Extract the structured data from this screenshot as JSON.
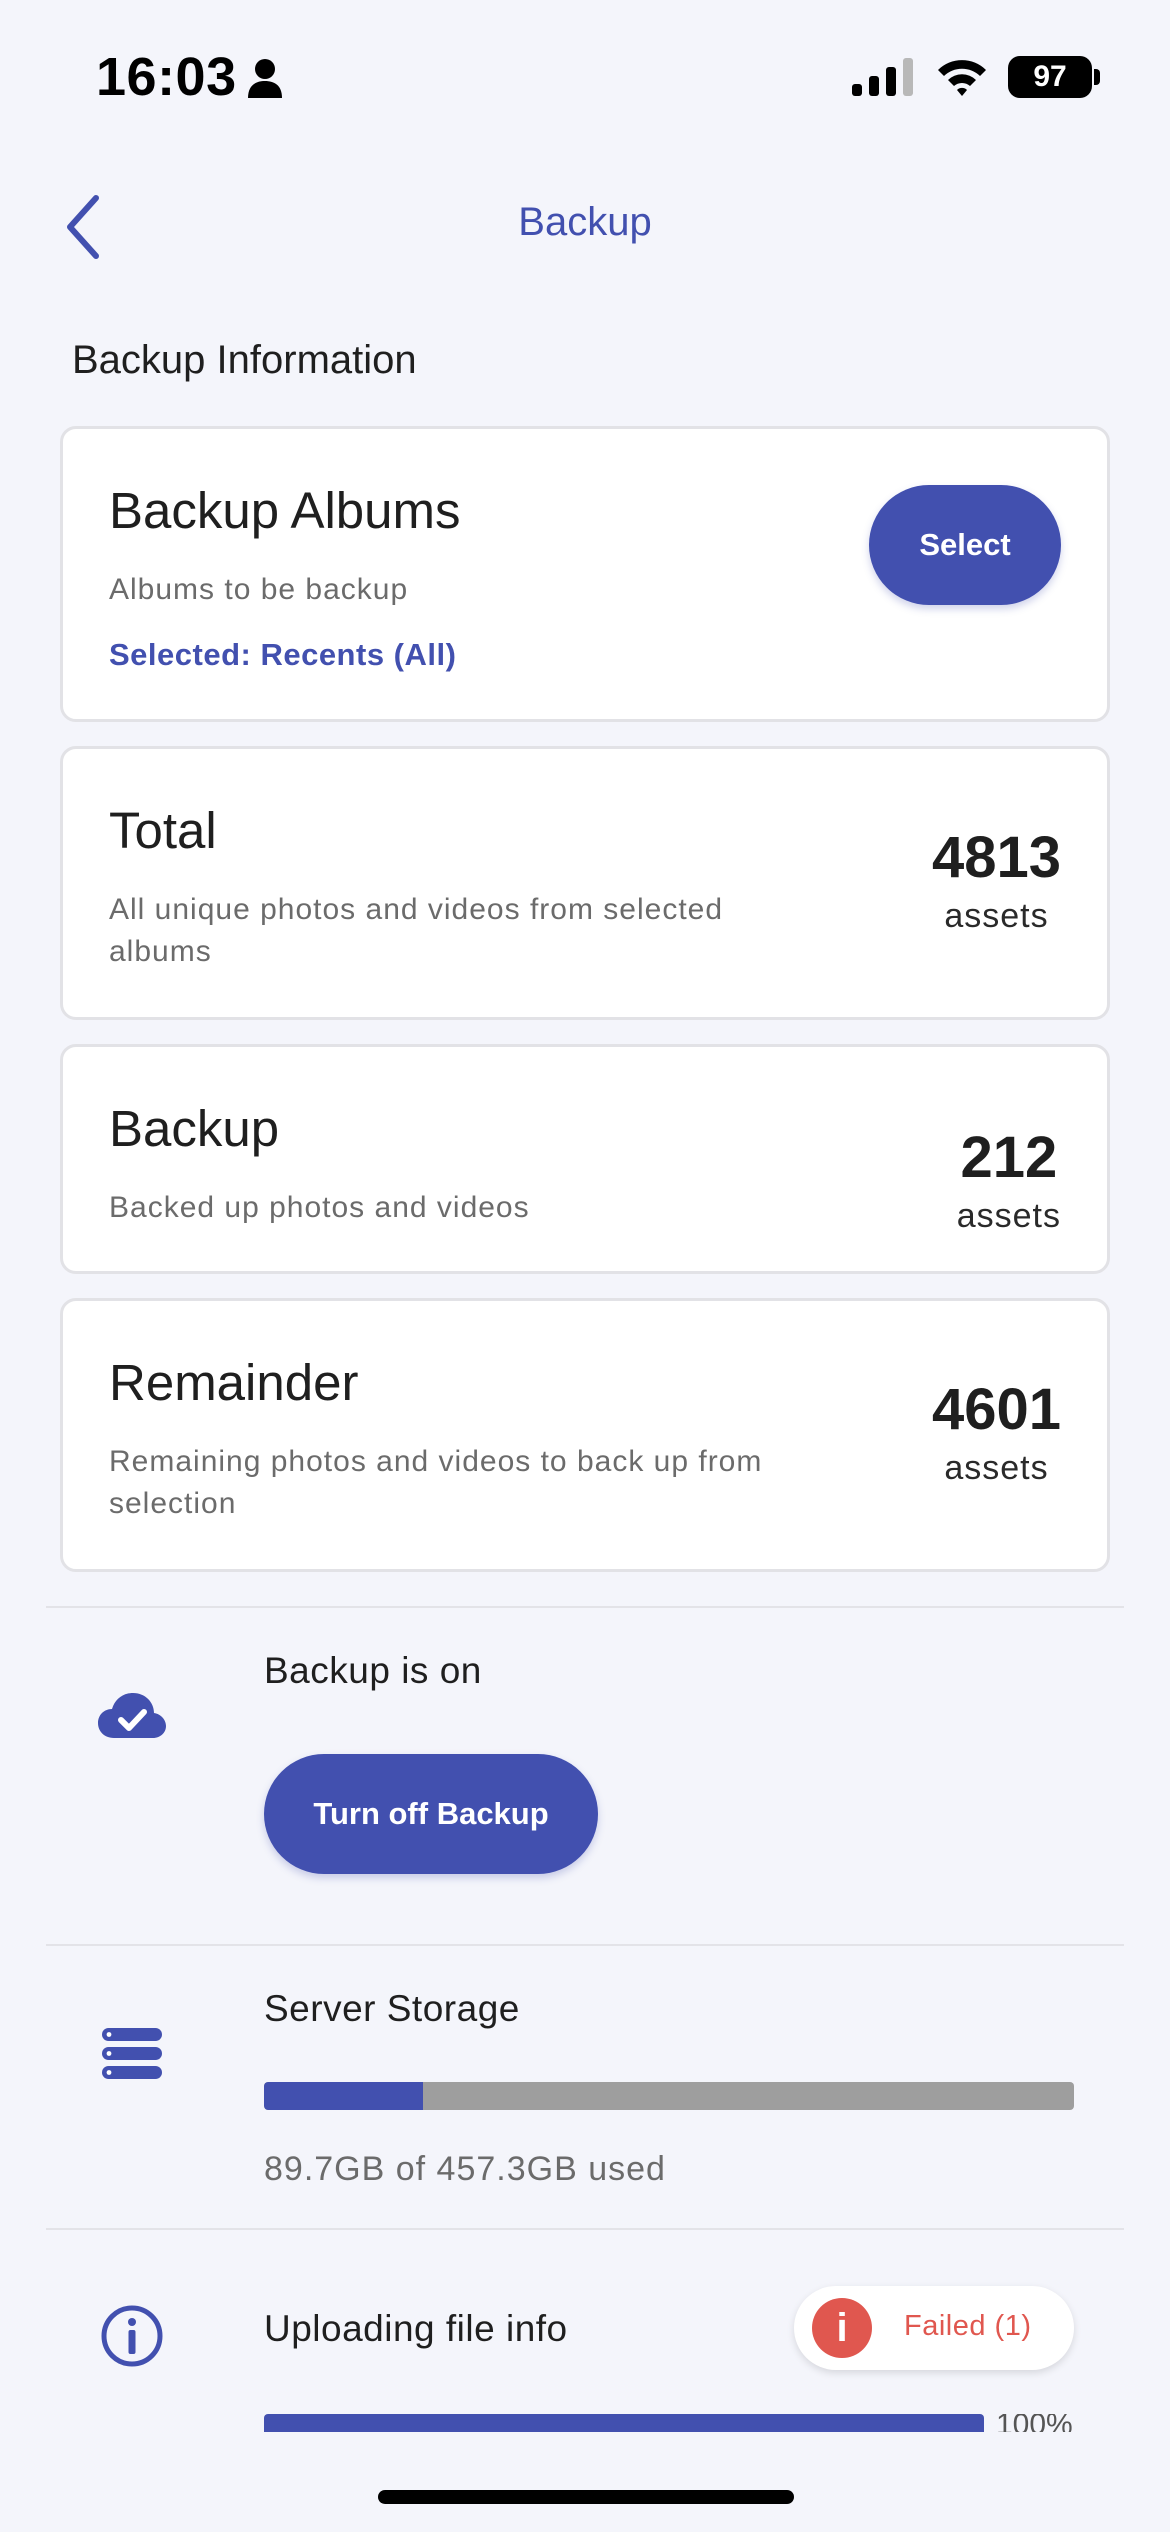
{
  "status_bar": {
    "time": "16:03",
    "battery": "97"
  },
  "nav": {
    "title": "Backup"
  },
  "section": {
    "title": "Backup Information"
  },
  "albums_card": {
    "title": "Backup Albums",
    "subtitle": "Albums to be backup",
    "selected": "Selected: Recents (All)",
    "button": "Select"
  },
  "total_card": {
    "title": "Total",
    "subtitle_line1": "All unique photos and videos from selected",
    "subtitle_line2": "albums",
    "count": "4813",
    "unit": "assets"
  },
  "backup_card": {
    "title": "Backup",
    "subtitle": "Backed up photos and videos",
    "count": "212",
    "unit": "assets"
  },
  "remainder_card": {
    "title": "Remainder",
    "subtitle_line1": "Remaining photos and videos to back up from",
    "subtitle_line2": "selection",
    "count": "4601",
    "unit": "assets"
  },
  "backup_status": {
    "label": "Backup is on",
    "button": "Turn off Backup",
    "icon": "cloud-check-icon"
  },
  "server_storage": {
    "label": "Server Storage",
    "used_fraction": 0.196,
    "text": "89.7GB of 457.3GB used",
    "icon": "server-icon"
  },
  "uploading": {
    "label": "Uploading file info",
    "failed_label": "Failed (1)",
    "progress_text": "100%",
    "icon": "info-icon"
  },
  "colors": {
    "accent": "#4250af",
    "error": "#e0574f",
    "background": "#f4f5fb",
    "bar_track": "#9e9e9e"
  }
}
